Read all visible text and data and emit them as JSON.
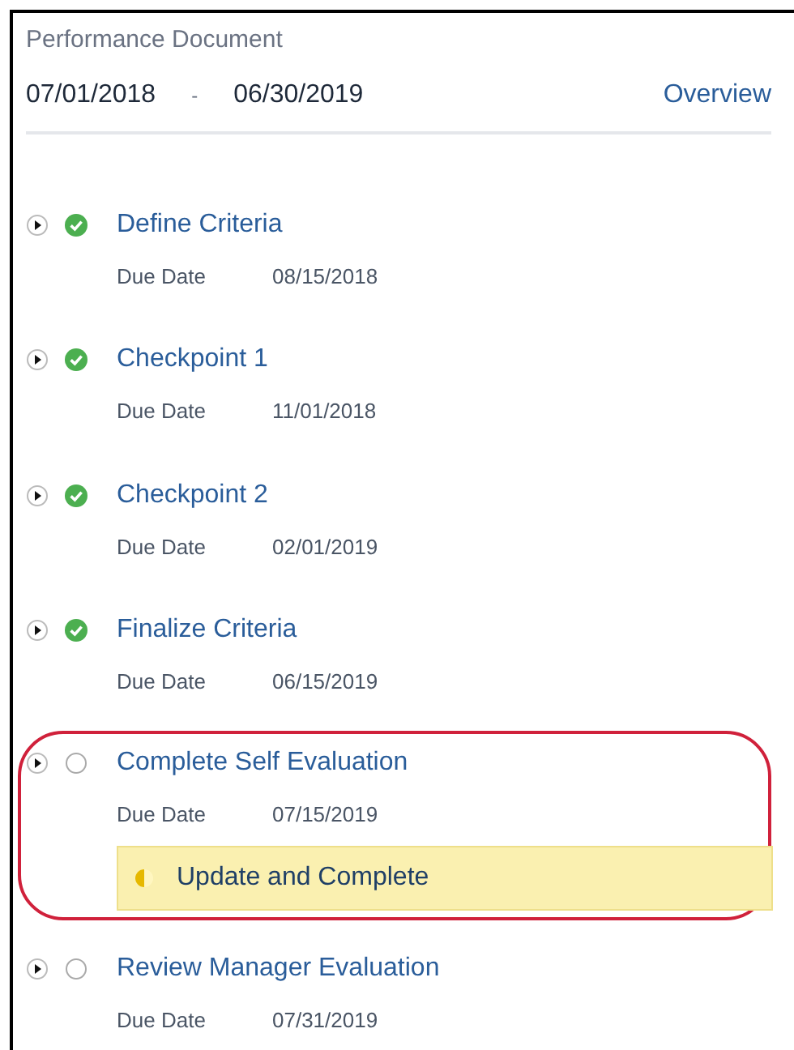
{
  "header": {
    "title": "Performance Document",
    "start_date": "07/01/2018",
    "separator": "-",
    "end_date": "06/30/2019",
    "link": "Overview"
  },
  "steps": [
    {
      "title": "Define Criteria",
      "due_label": "Due Date",
      "due_date": "08/15/2018",
      "completed": true,
      "highlighted": false
    },
    {
      "title": "Checkpoint 1",
      "due_label": "Due Date",
      "due_date": "11/01/2018",
      "completed": true,
      "highlighted": false
    },
    {
      "title": "Checkpoint 2",
      "due_label": "Due Date",
      "due_date": "02/01/2019",
      "completed": true,
      "highlighted": false
    },
    {
      "title": "Finalize Criteria",
      "due_label": "Due Date",
      "due_date": "06/15/2019",
      "completed": true,
      "highlighted": false
    },
    {
      "title": "Complete Self Evaluation",
      "due_label": "Due Date",
      "due_date": "07/15/2019",
      "completed": false,
      "highlighted": true,
      "action": "Update and Complete"
    },
    {
      "title": "Review Manager Evaluation",
      "due_label": "Due Date",
      "due_date": "07/31/2019",
      "completed": false,
      "highlighted": false
    }
  ]
}
